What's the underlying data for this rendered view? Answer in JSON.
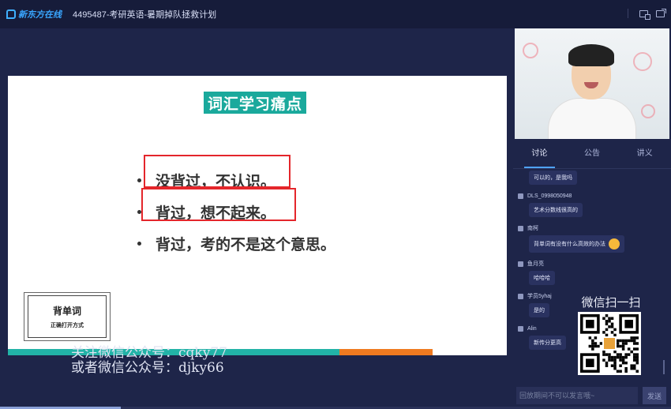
{
  "titlebar": {
    "logo_text": "新东方在线",
    "title": "4495487-考研英语-暑期掉队拯救计划"
  },
  "slide": {
    "title": "词汇学习痛点",
    "bullets": [
      "没背过，不认识。",
      "背过，想不起来。",
      "背过，考的不是这个意思。"
    ],
    "nav_title": "背单词",
    "nav_subtitle": "正确打开方式"
  },
  "watermark": {
    "line1": "关注微信公众号：cqky77",
    "line2": "或者微信公众号：djky66"
  },
  "sidebar": {
    "tabs": [
      "讨论",
      "公告",
      "讲义"
    ],
    "active_tab": 0
  },
  "chat": {
    "messages": [
      {
        "user": "",
        "text": "可以的，是我吗"
      },
      {
        "user": "DLS_0998050948",
        "text": "艺术分数线很高的"
      },
      {
        "user": "南柯",
        "text": "背单词有没有什么高效的办法"
      },
      {
        "user": "鱼月亮",
        "text": "哈哈哈"
      },
      {
        "user": "学员5yhaj",
        "text": "是的"
      },
      {
        "user": "Alin",
        "text": "新传分更高"
      }
    ]
  },
  "qr": {
    "label": "微信扫一扫"
  },
  "input": {
    "placeholder": "回放期间不可以发言哦~",
    "send_label": "发送"
  },
  "colors": {
    "accent_teal": "#1aa99c",
    "accent_orange": "#ef7a20",
    "highlight_red": "#e4262b",
    "bg_dark": "#1e2549"
  }
}
